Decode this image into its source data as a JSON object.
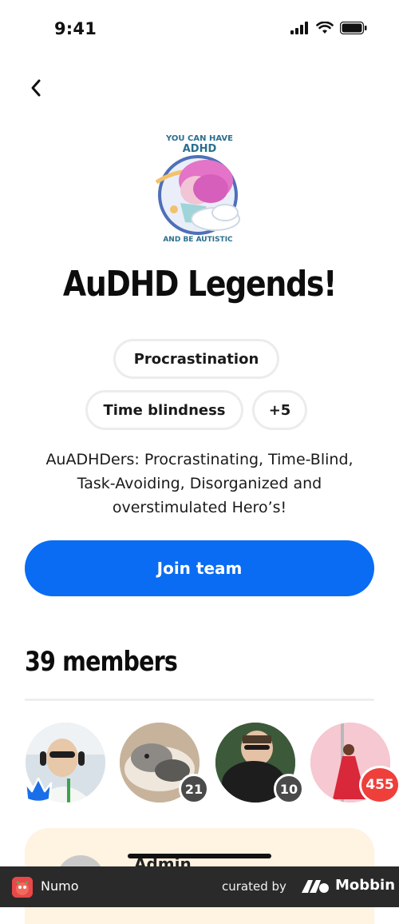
{
  "status_bar": {
    "time": "9:41"
  },
  "team": {
    "name": "AuDHD Legends!",
    "logo_text_top": "YOU CAN HAVE",
    "logo_text_mid": "ADHD",
    "logo_text_bottom": "AND BE AUTISTIC"
  },
  "tags": {
    "chip1": "Procrastination",
    "chip2": "Time blindness",
    "more": "+5"
  },
  "description": "AuADHDers: Procrastinating, Time-Blind, Task-Avoiding, Disorganized and overstimulated Hero’s!",
  "actions": {
    "join_label": "Join team"
  },
  "members": {
    "title": "39 members",
    "avatars": [
      {
        "badge": ""
      },
      {
        "badge": "21"
      },
      {
        "badge": "10"
      },
      {
        "badge": "455"
      }
    ]
  },
  "admin": {
    "label": "Admin"
  },
  "footer": {
    "app_name": "Numo",
    "curated_by": "curated by",
    "brand": "Mobbin"
  },
  "colors": {
    "primary": "#0a6cf2",
    "badge_red": "#ef3f3b",
    "badge_dark": "#4a4a4a",
    "crown_blue": "#1a6fe8",
    "admin_card_bg": "#fff3e1"
  }
}
